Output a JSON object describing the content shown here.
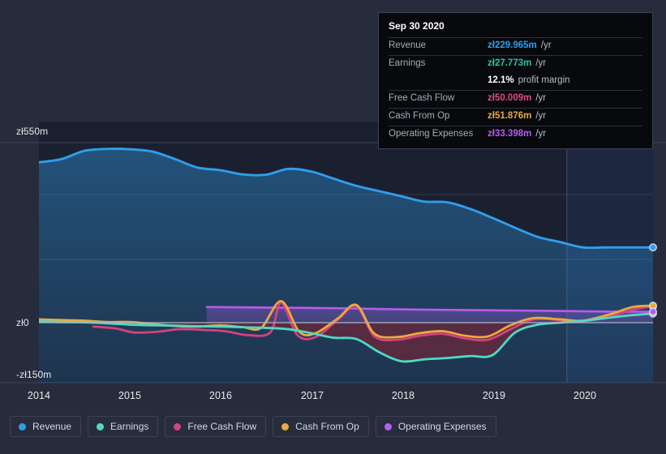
{
  "chart_data": {
    "type": "area",
    "title": "",
    "xlabel": "",
    "ylabel": "",
    "currency_symbol": "zł",
    "ylim": [
      -220,
      550
    ],
    "grid": true,
    "legend_position": "bottom",
    "y_ticks": [
      "zł550m",
      "zł0",
      "-zł150m"
    ],
    "y_tick_values": [
      550,
      0,
      -150
    ],
    "x_ticks": [
      "2014",
      "2015",
      "2016",
      "2017",
      "2018",
      "2019",
      "2020"
    ],
    "x_tick_values": [
      2014,
      2015,
      2016,
      2017,
      2018,
      2019,
      2020
    ],
    "forecast_divider_x": 2019.77,
    "series": [
      {
        "name": "Revenue",
        "color": "#2f9eeb",
        "x": [
          2013.95,
          2014.2,
          2014.45,
          2014.7,
          2014.95,
          2015.2,
          2015.45,
          2015.7,
          2015.95,
          2016.2,
          2016.45,
          2016.7,
          2016.95,
          2017.2,
          2017.45,
          2017.7,
          2017.95,
          2018.2,
          2018.45,
          2018.7,
          2018.95,
          2019.2,
          2019.45,
          2019.7,
          2019.95,
          2020.2,
          2020.45,
          2020.72
        ],
        "values": [
          490,
          500,
          525,
          531,
          530,
          523,
          500,
          474,
          466,
          453,
          452,
          470,
          462,
          440,
          418,
          402,
          386,
          370,
          368,
          348,
          320,
          290,
          262,
          246,
          230,
          230,
          230,
          230
        ]
      },
      {
        "name": "Earnings",
        "color": "#4fd9c4",
        "x": [
          2013.95,
          2014.2,
          2014.45,
          2014.7,
          2014.95,
          2015.2,
          2015.45,
          2015.7,
          2015.95,
          2016.2,
          2016.45,
          2016.7,
          2016.95,
          2017.2,
          2017.45,
          2017.7,
          2017.95,
          2018.2,
          2018.45,
          2018.7,
          2018.95,
          2019.2,
          2019.45,
          2019.7,
          2019.95,
          2020.2,
          2020.45,
          2020.72
        ],
        "values": [
          4,
          2,
          1,
          -2,
          -6,
          -8,
          -9,
          -11,
          -12,
          -14,
          -16,
          -20,
          -32,
          -46,
          -50,
          -90,
          -118,
          -112,
          -108,
          -102,
          -99,
          -30,
          -6,
          0,
          6,
          14,
          22,
          27.773
        ]
      },
      {
        "name": "Free Cash Flow",
        "color": "#d6417f",
        "x": [
          2014.55,
          2014.8,
          2015.0,
          2015.25,
          2015.5,
          2015.75,
          2016.0,
          2016.25,
          2016.5,
          2016.62,
          2016.8,
          2017.0,
          2017.25,
          2017.45,
          2017.65,
          2017.9,
          2018.15,
          2018.4,
          2018.65,
          2018.9,
          2019.15,
          2019.4,
          2019.7,
          2019.95,
          2020.25,
          2020.5,
          2020.72
        ],
        "values": [
          -12,
          -18,
          -30,
          -28,
          -20,
          -22,
          -26,
          -38,
          -30,
          60,
          -38,
          -44,
          10,
          50,
          -42,
          -52,
          -40,
          -34,
          -48,
          -52,
          -20,
          10,
          8,
          4,
          20,
          40,
          50.009
        ]
      },
      {
        "name": "Cash From Op",
        "color": "#eaa93e",
        "x": [
          2013.95,
          2014.2,
          2014.45,
          2014.7,
          2014.95,
          2015.2,
          2015.45,
          2015.7,
          2015.95,
          2016.2,
          2016.4,
          2016.62,
          2016.82,
          2017.0,
          2017.25,
          2017.45,
          2017.65,
          2017.9,
          2018.15,
          2018.4,
          2018.65,
          2018.9,
          2019.15,
          2019.4,
          2019.7,
          2019.95,
          2020.25,
          2020.5,
          2020.72
        ],
        "values": [
          10,
          8,
          6,
          2,
          2,
          -4,
          -10,
          -12,
          -8,
          -14,
          -16,
          66,
          -28,
          -32,
          14,
          54,
          -34,
          -44,
          -32,
          -26,
          -40,
          -42,
          -8,
          14,
          10,
          6,
          26,
          48,
          51.876
        ]
      },
      {
        "name": "Operating Expenses",
        "color": "#b65cf0",
        "x": [
          2015.8,
          2016.5,
          2017.3,
          2018.1,
          2018.9,
          2019.6,
          2020.2,
          2020.72
        ],
        "values": [
          48,
          46,
          44,
          40,
          38,
          36,
          34,
          33.398
        ]
      }
    ]
  },
  "tooltip": {
    "title": "Sep 30 2020",
    "rows": [
      {
        "key": "Revenue",
        "value": "zł229.965m",
        "unit": "/yr",
        "color": "#2f9eeb"
      },
      {
        "key": "Earnings",
        "value": "zł27.773m",
        "unit": "/yr",
        "color": "#26c5a8"
      },
      {
        "key": "",
        "value": "12.1%",
        "unit": "profit margin",
        "color": "#ffffff",
        "sub": true
      },
      {
        "key": "Free Cash Flow",
        "value": "zł50.009m",
        "unit": "/yr",
        "color": "#e0497f"
      },
      {
        "key": "Cash From Op",
        "value": "zł51.876m",
        "unit": "/yr",
        "color": "#eaa93e"
      },
      {
        "key": "Operating Expenses",
        "value": "zł33.398m",
        "unit": "/yr",
        "color": "#b65cf0"
      }
    ]
  },
  "legend": {
    "items": [
      {
        "label": "Revenue",
        "color": "#2f9eeb"
      },
      {
        "label": "Earnings",
        "color": "#4fd9c4"
      },
      {
        "label": "Free Cash Flow",
        "color": "#d6417f"
      },
      {
        "label": "Cash From Op",
        "color": "#eaa93e"
      },
      {
        "label": "Operating Expenses",
        "color": "#b65cf0"
      }
    ]
  },
  "colors": {
    "background": "#262c3b",
    "plot_background": "#1b2030",
    "forecast_background": "#1d2740",
    "gridline": "#3d4557",
    "zero_line": "#aeb4c2"
  }
}
